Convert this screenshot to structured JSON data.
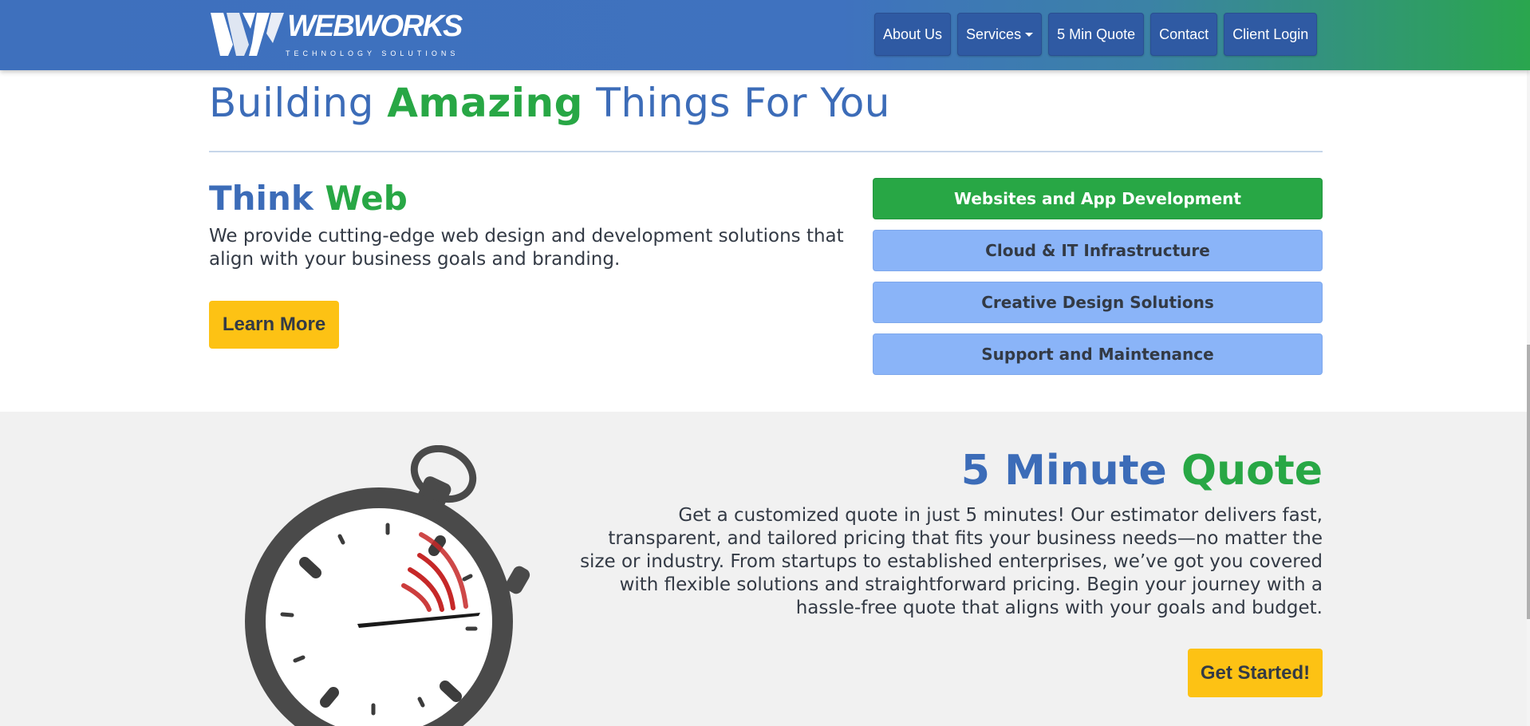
{
  "header": {
    "logo": {
      "wordmark": "WEBWORKS",
      "tagline": "TECHNOLOGY SOLUTIONS"
    },
    "nav": [
      {
        "label": "About Us"
      },
      {
        "label": "Services",
        "has_dropdown": true
      },
      {
        "label": "5 Min Quote"
      },
      {
        "label": "Contact"
      },
      {
        "label": "Client Login"
      }
    ]
  },
  "hero": {
    "title_pre": "Building ",
    "title_highlight": "Amazing",
    "title_post": " Things For You"
  },
  "think": {
    "title_pre": "Think ",
    "title_highlight": "Web",
    "description": "We provide cutting-edge web design and development solutions that align with your business goals and branding.",
    "button": "Learn More"
  },
  "services": [
    {
      "label": "Websites and App Development",
      "active": true
    },
    {
      "label": "Cloud & IT Infrastructure",
      "active": false
    },
    {
      "label": "Creative Design Solutions",
      "active": false
    },
    {
      "label": "Support and Maintenance",
      "active": false
    }
  ],
  "quote": {
    "title_pre": "5 Minute ",
    "title_highlight": "Quote",
    "description": "Get a customized quote in just 5 minutes! Our estimator delivers fast, transparent, and tailored pricing that fits your business needs—no matter the size or industry. From startups to established enterprises, we’ve got you covered with flexible solutions and straightforward pricing. Begin your journey with a hassle-free quote that aligns with your goals and budget.",
    "button": "Get Started!"
  },
  "colors": {
    "primary_blue": "#3c6cb8",
    "accent_green": "#28a745",
    "button_yellow": "#fdc214",
    "service_blue": "#8ab4f8",
    "section_gray": "#f1f1f1"
  },
  "icons": [
    "webworks-logo-icon",
    "stopwatch-icon"
  ]
}
